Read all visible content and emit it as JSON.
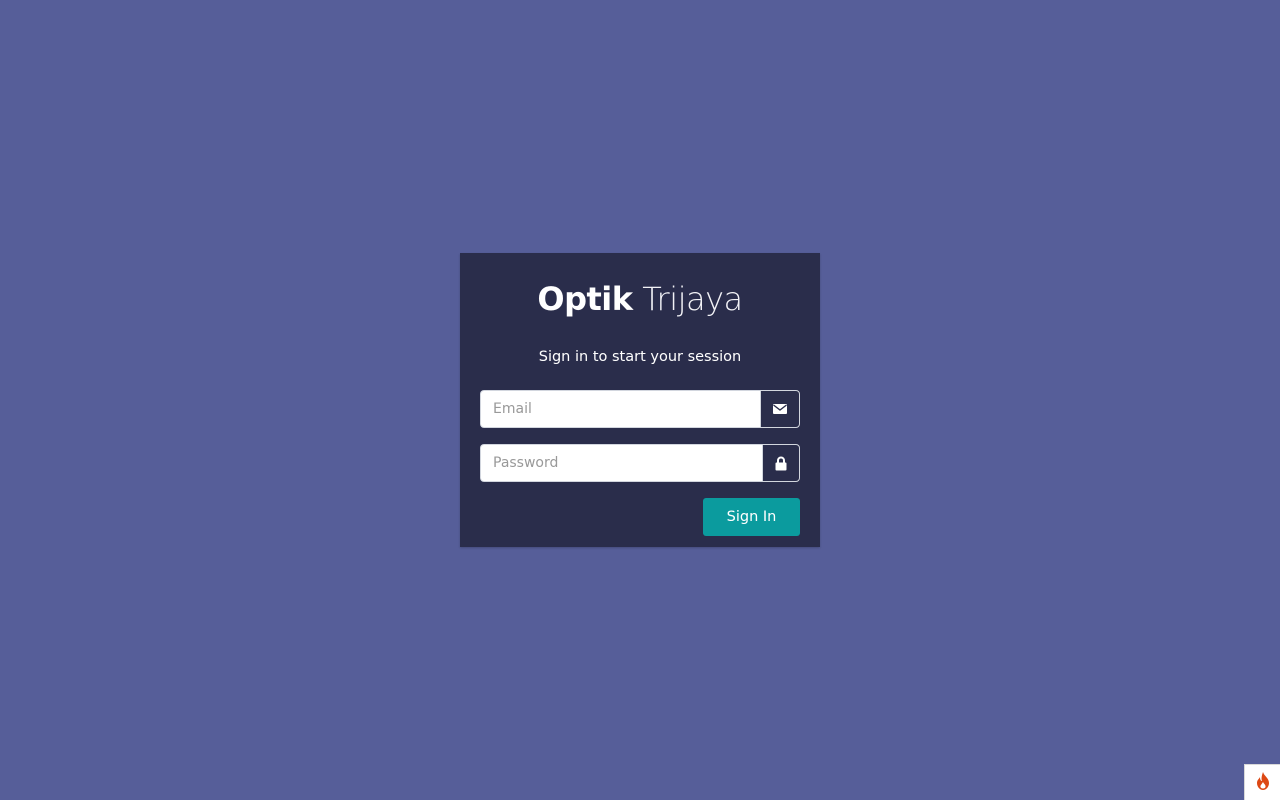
{
  "brand": {
    "name_bold": "Optik",
    "name_light": "Trijaya"
  },
  "login": {
    "subtitle": "Sign in to start your session",
    "email": {
      "value": "",
      "placeholder": "Email",
      "icon": "envelope-icon"
    },
    "password": {
      "value": "",
      "placeholder": "Password",
      "icon": "lock-icon"
    },
    "submit_label": "Sign In"
  },
  "toolbar_badge": {
    "icon": "flame-icon"
  },
  "colors": {
    "page_background": "#565e99",
    "box_background": "#2a2d4b",
    "button": "#0b9b9e",
    "badge_flame": "#dd4814"
  }
}
